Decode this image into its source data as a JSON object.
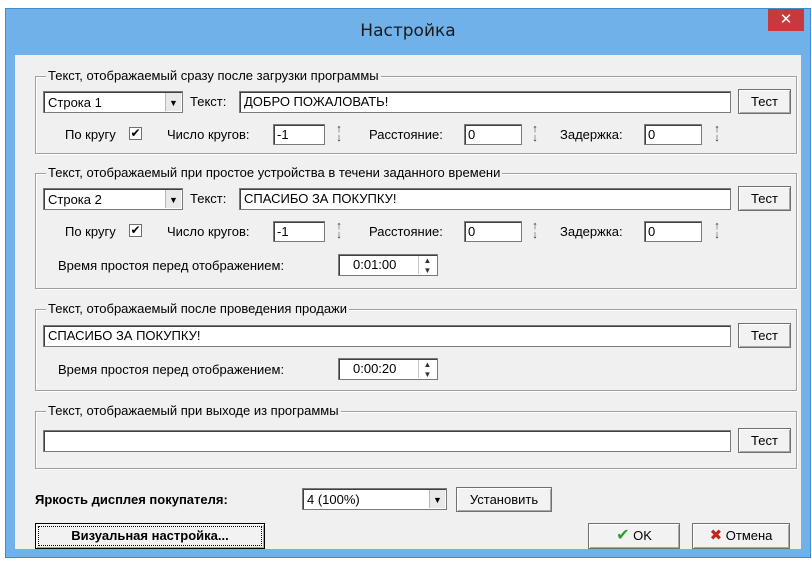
{
  "window": {
    "title": "Настройка",
    "close_glyph": "✕"
  },
  "group1": {
    "legend": "Текст, отображаемый сразу после загрузки программы",
    "line_select": "Строка 1",
    "text_label": "Текст:",
    "text_value": "ДОБРО ПОЖАЛОВАТЬ!",
    "test_button": "Тест",
    "loop_label": "По кругу",
    "loop_checked": true,
    "loops_label": "Число кругов:",
    "loops_value": "-1",
    "distance_label": "Расстояние:",
    "distance_value": "0",
    "delay_label": "Задержка:",
    "delay_value": "0"
  },
  "group2": {
    "legend": "Текст, отображаемый при простое устройства в течени заданного времени",
    "line_select": "Строка 2",
    "text_label": "Текст:",
    "text_value": "СПАСИБО ЗА ПОКУПКУ!",
    "test_button": "Тест",
    "loop_label": "По кругу",
    "loop_checked": true,
    "loops_label": "Число кругов:",
    "loops_value": "-1",
    "distance_label": "Расстояние:",
    "distance_value": "0",
    "delay_label": "Задержка:",
    "delay_value": "0",
    "idle_label": "Время простоя перед отображением:",
    "idle_value": "0:01:00"
  },
  "group3": {
    "legend": "Текст, отображаемый после проведения продажи",
    "text_value": "СПАСИБО ЗА ПОКУПКУ!",
    "test_button": "Тест",
    "idle_label": "Время простоя перед отображением:",
    "idle_value": "0:00:20"
  },
  "group4": {
    "legend": "Текст, отображаемый при выходе из программы",
    "text_value": "",
    "test_button": "Тест"
  },
  "brightness": {
    "label": "Яркость дисплея покупателя:",
    "value": "4 (100%)",
    "set_button": "Установить"
  },
  "footer": {
    "visual_button": "Визуальная настройка...",
    "ok_button": "OK",
    "cancel_button": "Отмена"
  },
  "colors": {
    "title_bar": "#6fb1e8",
    "close_button": "#c8383d",
    "ok_check": "#2aa02a",
    "cancel_x": "#c0281e"
  }
}
